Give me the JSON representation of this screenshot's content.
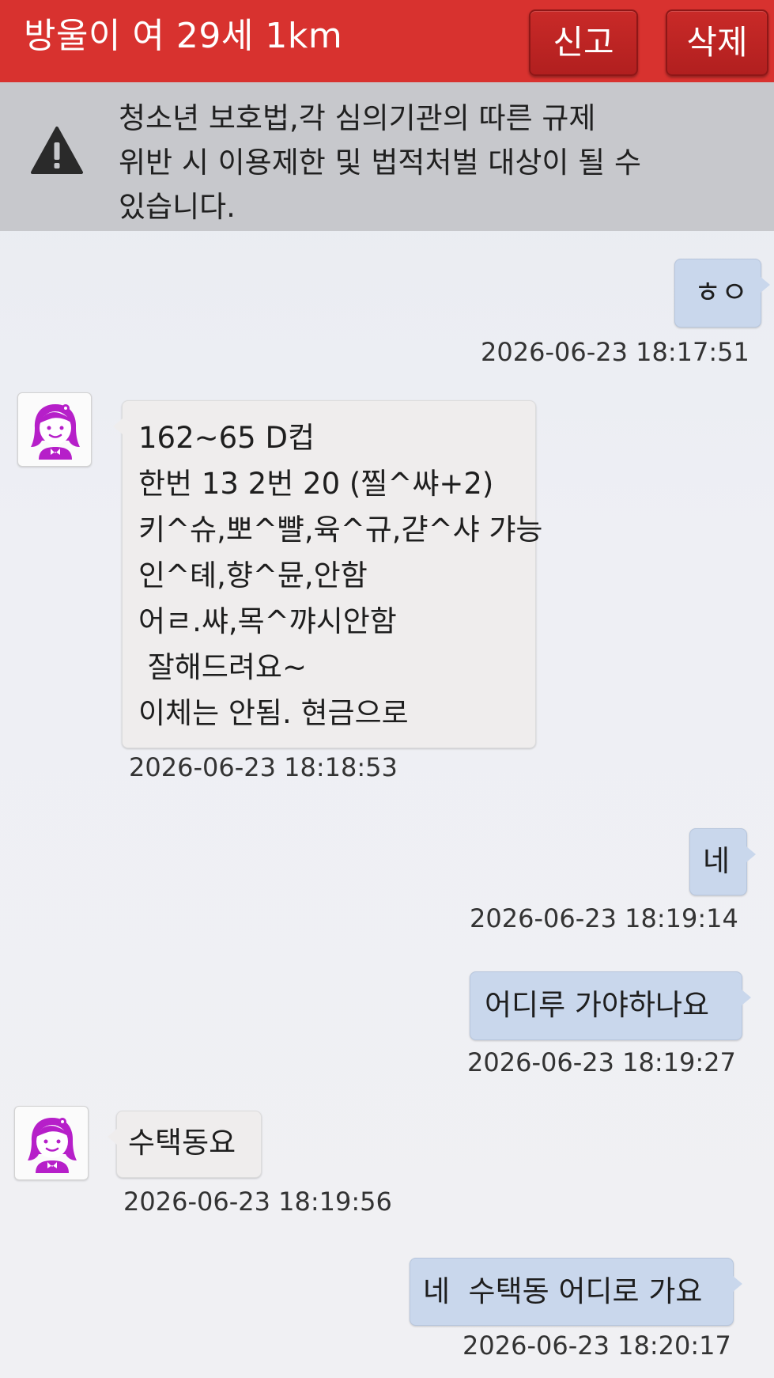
{
  "header": {
    "title": "방울이 여 29세 1km",
    "report_label": "신고",
    "delete_label": "삭제",
    "color": "#d8322f"
  },
  "warning": {
    "icon": "warning-icon",
    "text": "청소년 보호법,각 심의기관의 따른 규제\n위반 시 이용제한 및 법적처벌 대상이 될 수\n있습니다."
  },
  "messages": [
    {
      "direction": "out",
      "text": "ㅎㅇ",
      "time": "2026-06-23 18:17:51"
    },
    {
      "direction": "in",
      "avatar": "girl-avatar-icon",
      "text": "162~65 D컵\n한번 13 2번 20 (찔^쌰+2)\n키^슈,뽀^뺠,육^규,갿^샤 갸능\n인^톄,향^뮨,안함\n어ㄹ.쌰,목^꺄시안함\n 잘해드려요~\n이체는 안됨. 현금으로",
      "time": "2026-06-23 18:18:53"
    },
    {
      "direction": "out",
      "text": "네",
      "time": "2026-06-23 18:19:14"
    },
    {
      "direction": "out",
      "text": "어디루 가야하나요",
      "time": "2026-06-23 18:19:27"
    },
    {
      "direction": "in",
      "avatar": "girl-avatar-icon",
      "text": "수택동요",
      "time": "2026-06-23 18:19:56"
    },
    {
      "direction": "out",
      "text": "네  수택동 어디로 가요",
      "time": "2026-06-23 18:20:17"
    }
  ],
  "colors": {
    "outgoing_bubble": "#c9d7ec",
    "incoming_bubble": "#efeded",
    "avatar_accent": "#b61fc9"
  }
}
